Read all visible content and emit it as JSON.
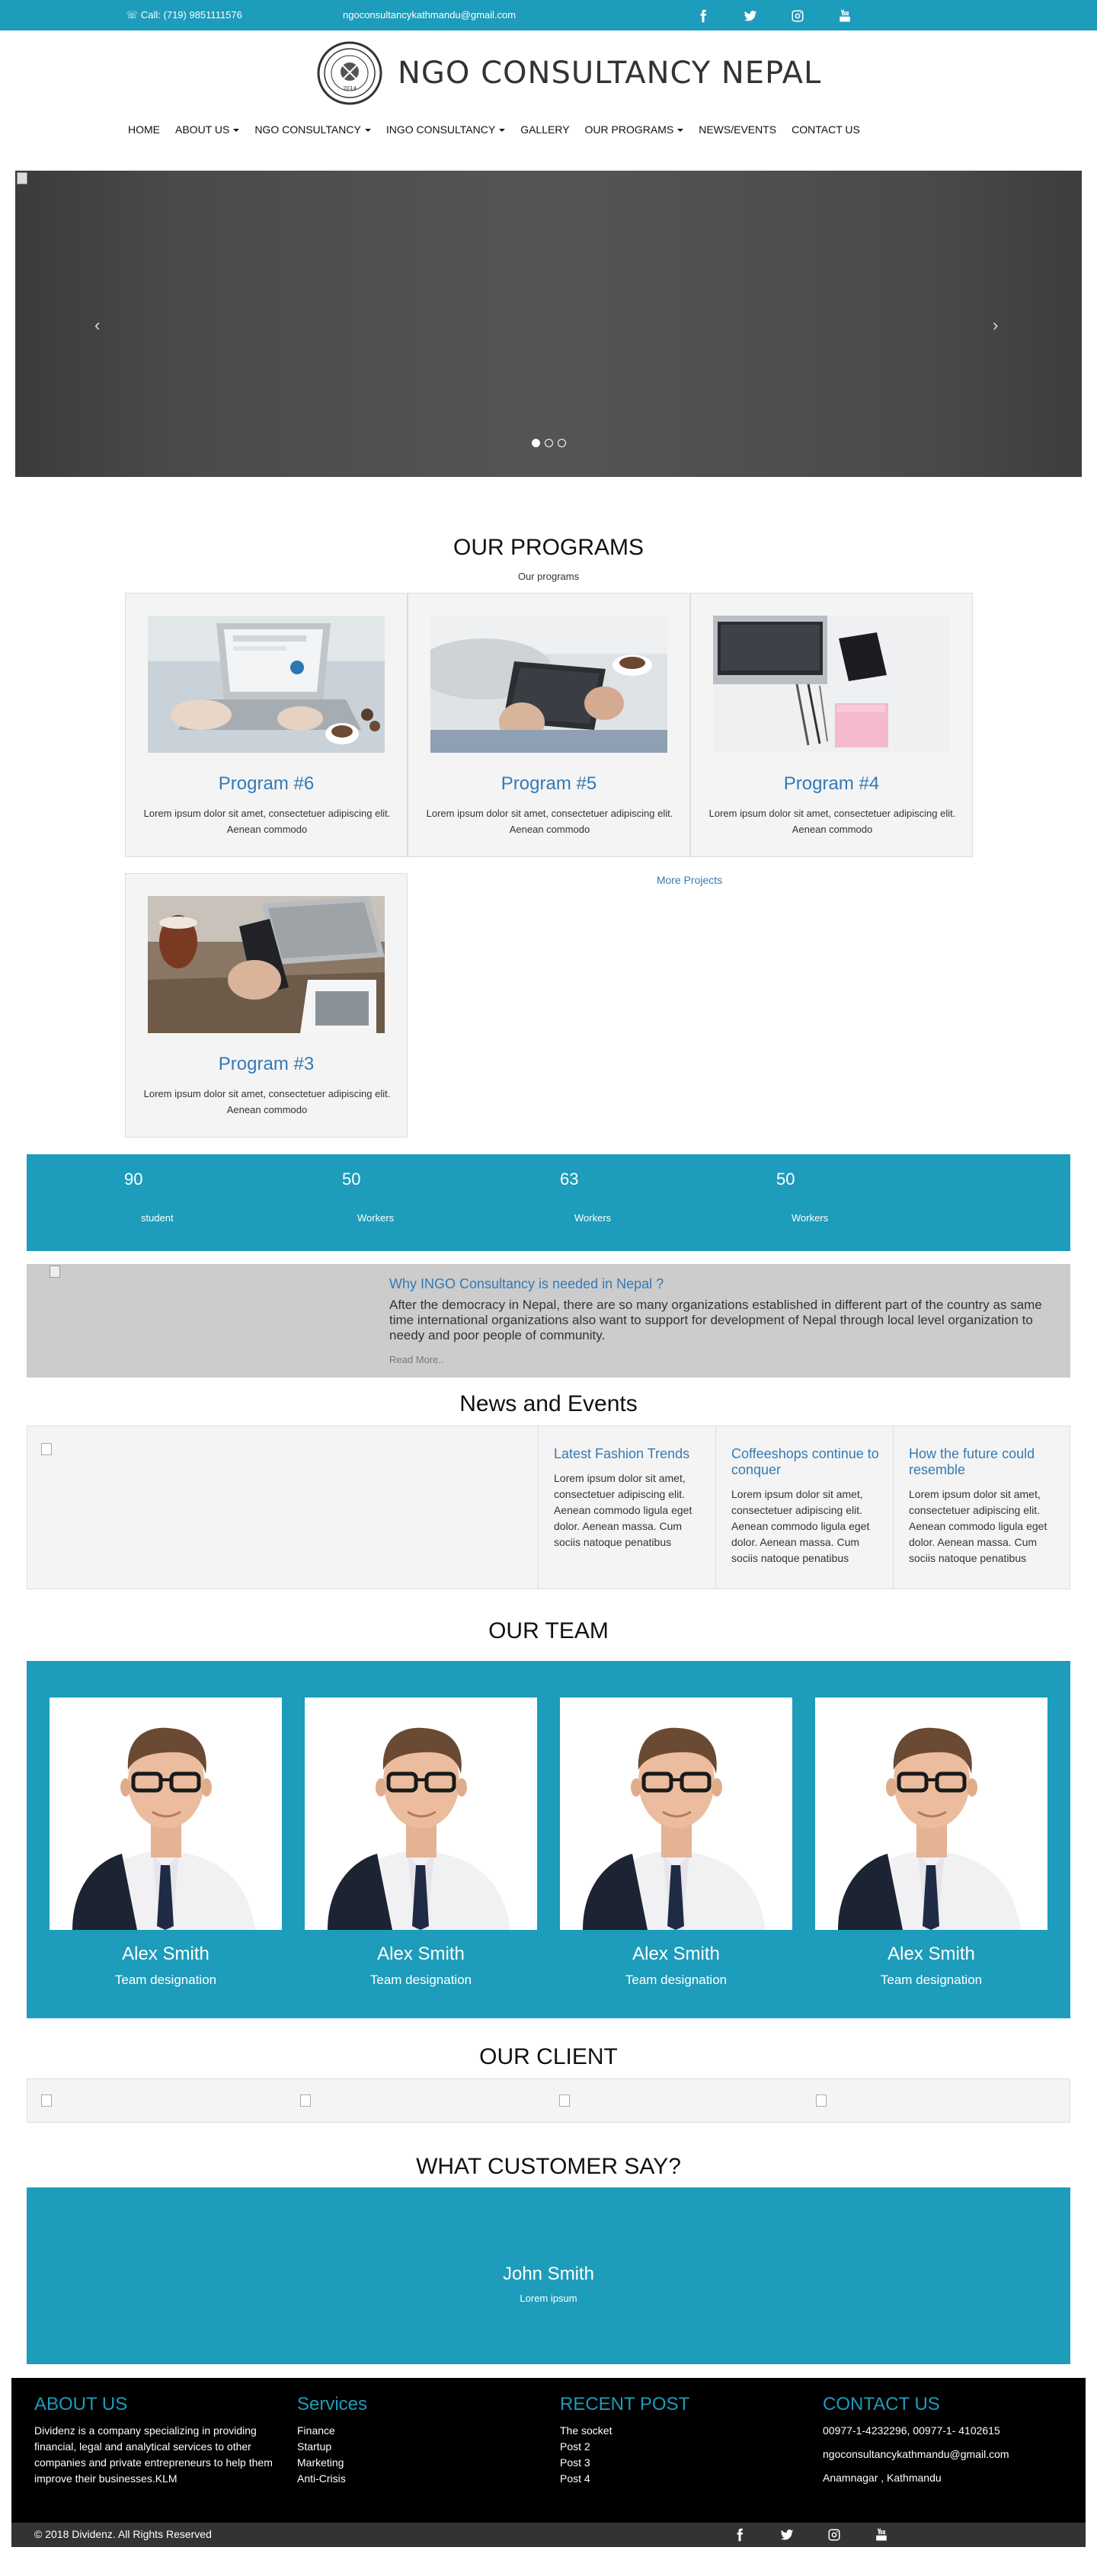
{
  "topbar": {
    "call": "Call: (719) 9851111576",
    "email": "ngoconsultancykathmandu@gmail.com",
    "social": [
      "facebook-icon",
      "twitter-icon",
      "instagram-icon",
      "youtube-icon"
    ]
  },
  "header": {
    "logo_text": "NGO CONSULTANCY NEPAL",
    "seal_year": "2014"
  },
  "nav": [
    {
      "label": "HOME",
      "dropdown": false
    },
    {
      "label": "ABOUT US",
      "dropdown": true
    },
    {
      "label": "NGO CONSULTANCY",
      "dropdown": true
    },
    {
      "label": "INGO CONSULTANCY",
      "dropdown": true
    },
    {
      "label": "GALLERY",
      "dropdown": false
    },
    {
      "label": "OUR PROGRAMS",
      "dropdown": true
    },
    {
      "label": "NEWS/EVENTS",
      "dropdown": false
    },
    {
      "label": "CONTACT US",
      "dropdown": false
    }
  ],
  "slider": {
    "prev": "‹",
    "next": "›",
    "dots": 3,
    "active": 0
  },
  "programs": {
    "title": "OUR PROGRAMS",
    "subtitle": "Our programs",
    "items": [
      {
        "name": "Program #6",
        "desc": "Lorem ipsum dolor sit amet, consectetuer adipiscing elit. Aenean commodo"
      },
      {
        "name": "Program #5",
        "desc": "Lorem ipsum dolor sit amet, consectetuer adipiscing elit. Aenean commodo"
      },
      {
        "name": "Program #4",
        "desc": "Lorem ipsum dolor sit amet, consectetuer adipiscing elit. Aenean commodo"
      },
      {
        "name": "Program #3",
        "desc": "Lorem ipsum dolor sit amet, consectetuer adipiscing elit. Aenean commodo"
      }
    ],
    "more": "More Projects"
  },
  "stats": [
    {
      "num": "90",
      "label": "student"
    },
    {
      "num": "50",
      "label": "Workers"
    },
    {
      "num": "63",
      "label": "Workers"
    },
    {
      "num": "50",
      "label": "Workers"
    }
  ],
  "why": {
    "title": "Why INGO Consultancy is needed in Nepal ?",
    "text": "After the democracy in Nepal, there are so many organizations established in different part of the country as same time international organizations also want to support for development of Nepal through local level organization to needy and poor people of community.",
    "read_more": "Read More.."
  },
  "news": {
    "title": "News and Events",
    "items": [
      {
        "title": "Latest Fashion Trends",
        "text": "Lorem ipsum dolor sit amet, consectetuer adipiscing elit. Aenean commodo ligula eget dolor. Aenean massa. Cum sociis natoque penatibus"
      },
      {
        "title": "Coffeeshops continue to conquer",
        "text": "Lorem ipsum dolor sit amet, consectetuer adipiscing elit. Aenean commodo ligula eget dolor. Aenean massa. Cum sociis natoque penatibus"
      },
      {
        "title": "How the future could resemble",
        "text": "Lorem ipsum dolor sit amet, consectetuer adipiscing elit. Aenean commodo ligula eget dolor. Aenean massa. Cum sociis natoque penatibus"
      }
    ]
  },
  "team": {
    "title": "OUR TEAM",
    "members": [
      {
        "name": "Alex Smith",
        "designation": "Team designation"
      },
      {
        "name": "Alex Smith",
        "designation": "Team designation"
      },
      {
        "name": "Alex Smith",
        "designation": "Team designation"
      },
      {
        "name": "Alex Smith",
        "designation": "Team designation"
      }
    ]
  },
  "clients": {
    "title": "OUR CLIENT"
  },
  "testimonial": {
    "title": "WHAT CUSTOMER SAY?",
    "name": "John Smith",
    "text": "Lorem ipsum"
  },
  "footer": {
    "about": {
      "title": "ABOUT US",
      "text": "Dividenz is a company specializing in providing financial, legal and analytical services to other companies and private entrepreneurs to help them improve their businesses.KLM"
    },
    "services": {
      "title": "Services",
      "items": [
        "Finance",
        "Startup",
        "Marketing",
        "Anti-Crisis"
      ]
    },
    "recent": {
      "title": "RECENT POST",
      "items": [
        "The socket",
        "Post 2",
        "Post 3",
        "Post 4"
      ]
    },
    "contact": {
      "title": "CONTACT US",
      "phone": "00977-1-4232296, 00977-1- 4102615",
      "email": "ngoconsultancykathmandu@gmail.com",
      "address": "Anamnagar , Kathmandu"
    },
    "copyright": "© 2018 Dividenz. All Rights Reserved"
  },
  "colors": {
    "primary": "#1d9cbb",
    "link": "#337ab7",
    "footer_bg": "#000000"
  }
}
